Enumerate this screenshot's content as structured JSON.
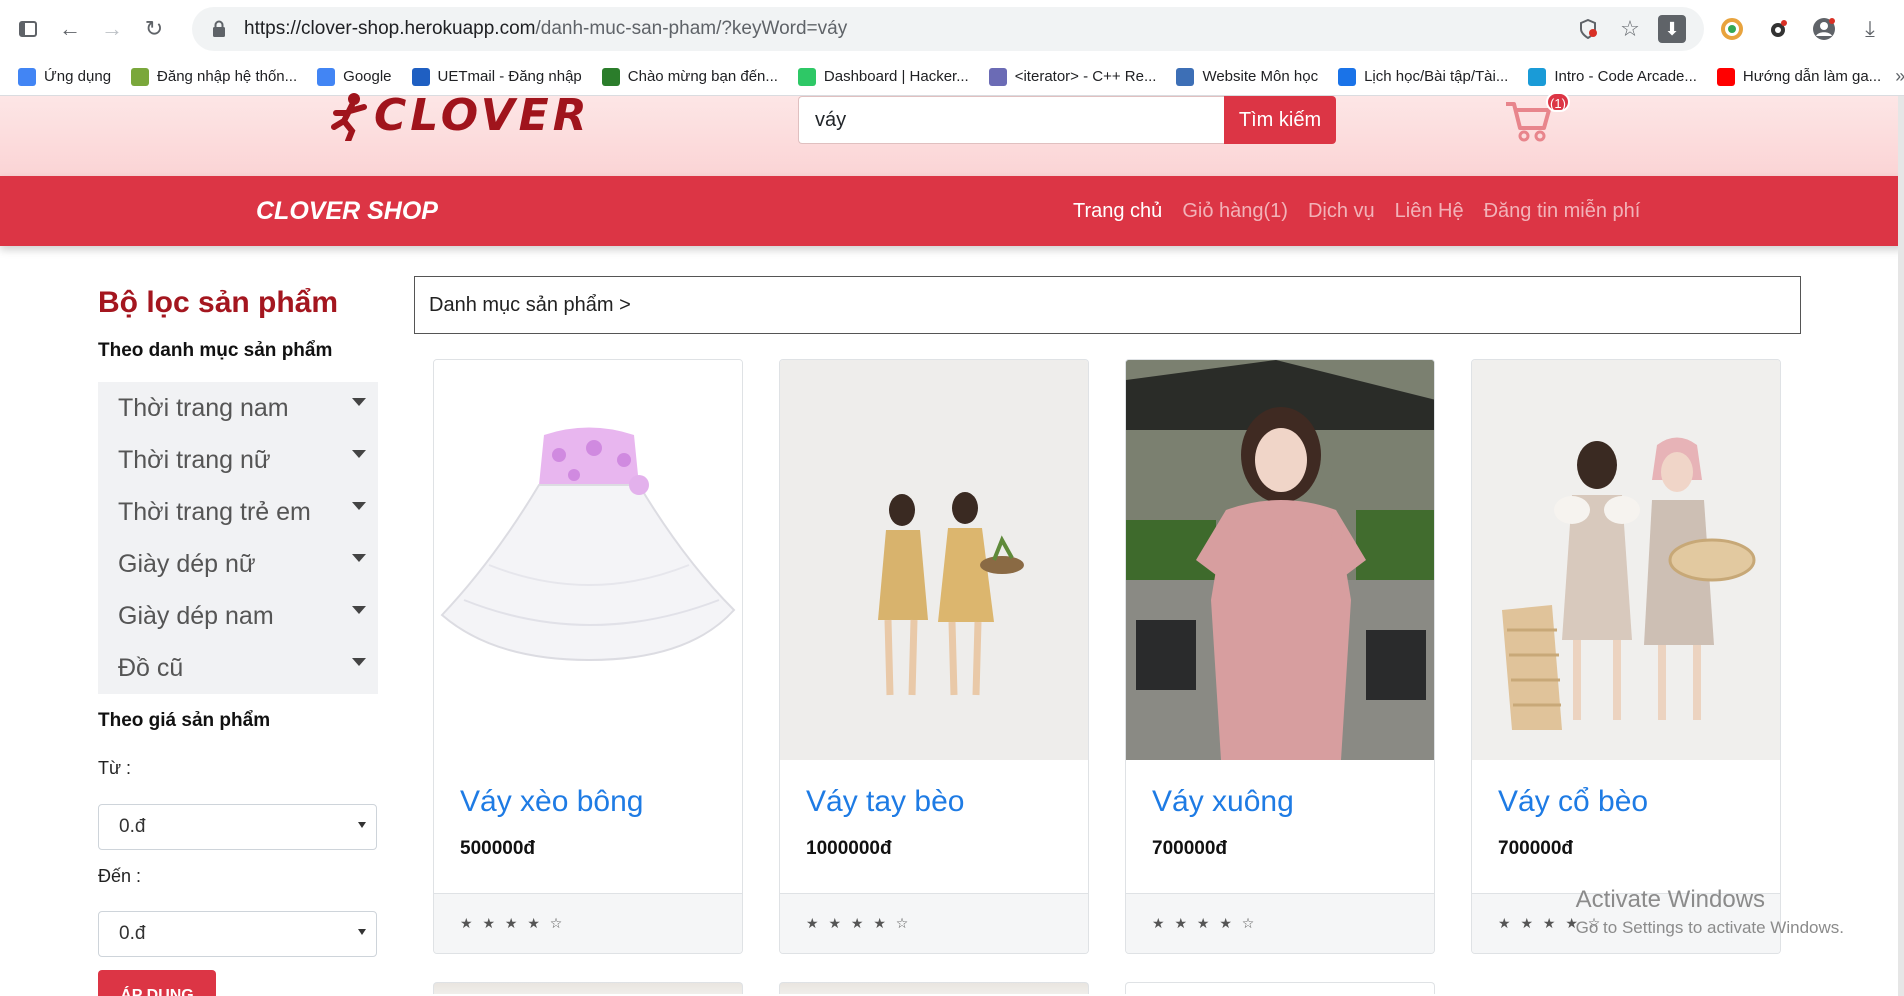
{
  "browser": {
    "url_host": "https://clover-shop.herokuapp.com",
    "url_path": "/danh-muc-san-pham/?keyWord=váy",
    "bookmarks": [
      {
        "label": "Ứng dụng",
        "icon": "apps-icon",
        "color": "#4285f4"
      },
      {
        "label": "Đăng nhập hệ thốn...",
        "icon": "globe-icon",
        "color": "#7aa73b"
      },
      {
        "label": "Google",
        "icon": "google-icon",
        "color": "#4285f4"
      },
      {
        "label": "UETmail - Đăng nhập",
        "icon": "info-icon",
        "color": "#1f5fc2"
      },
      {
        "label": "Chào mừng bạn đến...",
        "icon": "code-icon",
        "color": "#2b7d2b"
      },
      {
        "label": "Dashboard | Hacker...",
        "icon": "hackerrank-icon",
        "color": "#2ec866"
      },
      {
        "label": "<iterator> - C++ Re...",
        "icon": "cpp-icon",
        "color": "#6b6bb5"
      },
      {
        "label": "Website Môn học",
        "icon": "moodle-icon",
        "color": "#3d6fb6"
      },
      {
        "label": "Lịch học/Bài tập/Tài...",
        "icon": "calendar-icon",
        "color": "#1a73e8"
      },
      {
        "label": "Intro - Code Arcade...",
        "icon": "codesignal-icon",
        "color": "#1a9bd7"
      },
      {
        "label": "Hướng dẫn làm ga...",
        "icon": "youtube-icon",
        "color": "#ff0000"
      }
    ]
  },
  "header": {
    "logo_text": "CLOVER",
    "search_value": "váy",
    "search_button": "Tìm kiếm",
    "cart_count": "(1)"
  },
  "navbar": {
    "brand": "CLOVER SHOP",
    "links": [
      "Trang chủ",
      "Giỏ hàng(1)",
      "Dịch vụ",
      "Liên Hệ",
      "Đăng tin miễn phí"
    ]
  },
  "sidebar": {
    "title": "Bộ lọc sản phẩm",
    "category_heading": "Theo danh mục sản phẩm",
    "categories": [
      "Thời trang nam",
      "Thời trang nữ",
      "Thời trang trẻ em",
      "Giày dép nữ",
      "Giày dép nam",
      "Đồ cũ"
    ],
    "price_heading": "Theo giá sản phẩm",
    "from_label": "Từ :",
    "from_value": "0.đ",
    "to_label": "Đến :",
    "to_value": "0.đ",
    "apply_button": "ÁP DỤNG"
  },
  "breadcrumb": "Danh mục sản phẩm >",
  "products": [
    {
      "name": "Váy xèo bông",
      "price": "500000đ",
      "stars": "★ ★ ★ ★ ☆"
    },
    {
      "name": "Váy tay bèo",
      "price": "1000000đ",
      "stars": "★ ★ ★ ★ ☆"
    },
    {
      "name": "Váy xuông",
      "price": "700000đ",
      "stars": "★ ★ ★ ★ ☆"
    },
    {
      "name": "Váy cổ bèo",
      "price": "700000đ",
      "stars": "★ ★ ★ ★ ☆"
    }
  ],
  "watermark": {
    "line1": "Activate Windows",
    "line2": "Go to Settings to activate Windows."
  },
  "colors": {
    "brand_red": "#dc3545",
    "logo_red": "#a0141c",
    "link_blue": "#1e7be4"
  }
}
